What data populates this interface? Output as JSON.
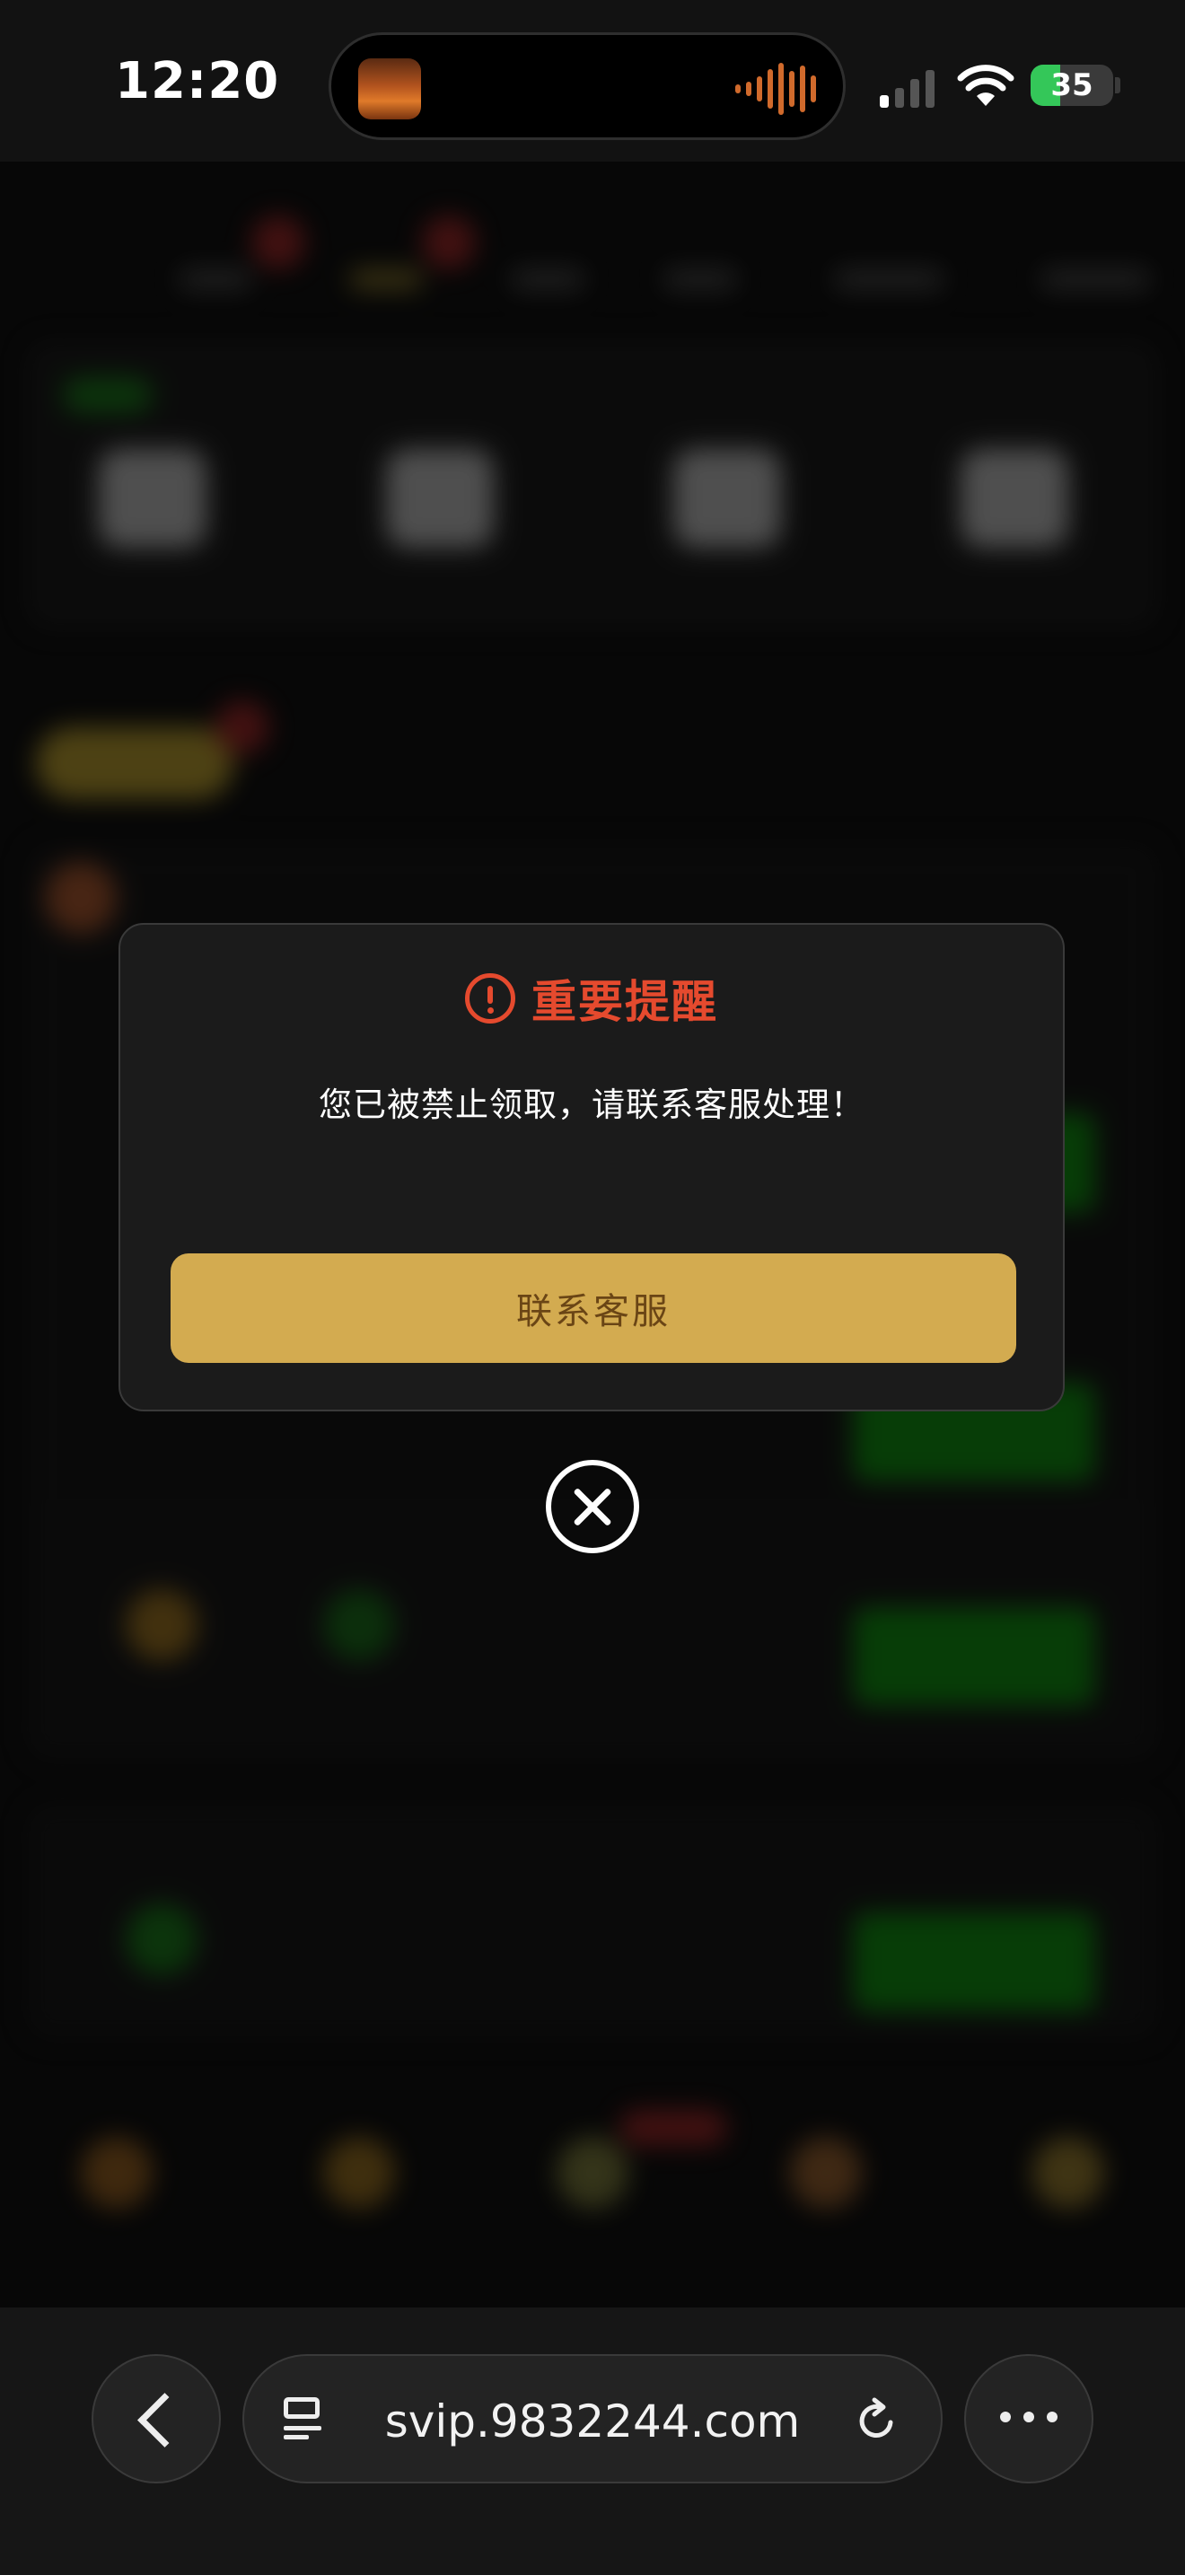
{
  "status_bar": {
    "time": "12:20",
    "battery": "35"
  },
  "modal": {
    "title": "重要提醒",
    "message": "您已被禁止领取，请联系客服处理！",
    "button_label": "联系客服"
  },
  "browser": {
    "url": "svip.9832244.com"
  },
  "icons": {
    "warning": "warning-circle-icon",
    "close": "close-circle-icon",
    "back": "chevron-left-icon",
    "tabs": "tab-list-icon",
    "reload": "reload-icon",
    "more": "more-dots-icon",
    "wifi": "wifi-icon",
    "signal": "cellular-signal-icon",
    "battery": "battery-charging-icon"
  },
  "colors": {
    "alert_red": "#e54a2e",
    "button_gold": "#d3ab50",
    "button_text": "#6a4515",
    "modal_bg": "#1b1b1b"
  }
}
